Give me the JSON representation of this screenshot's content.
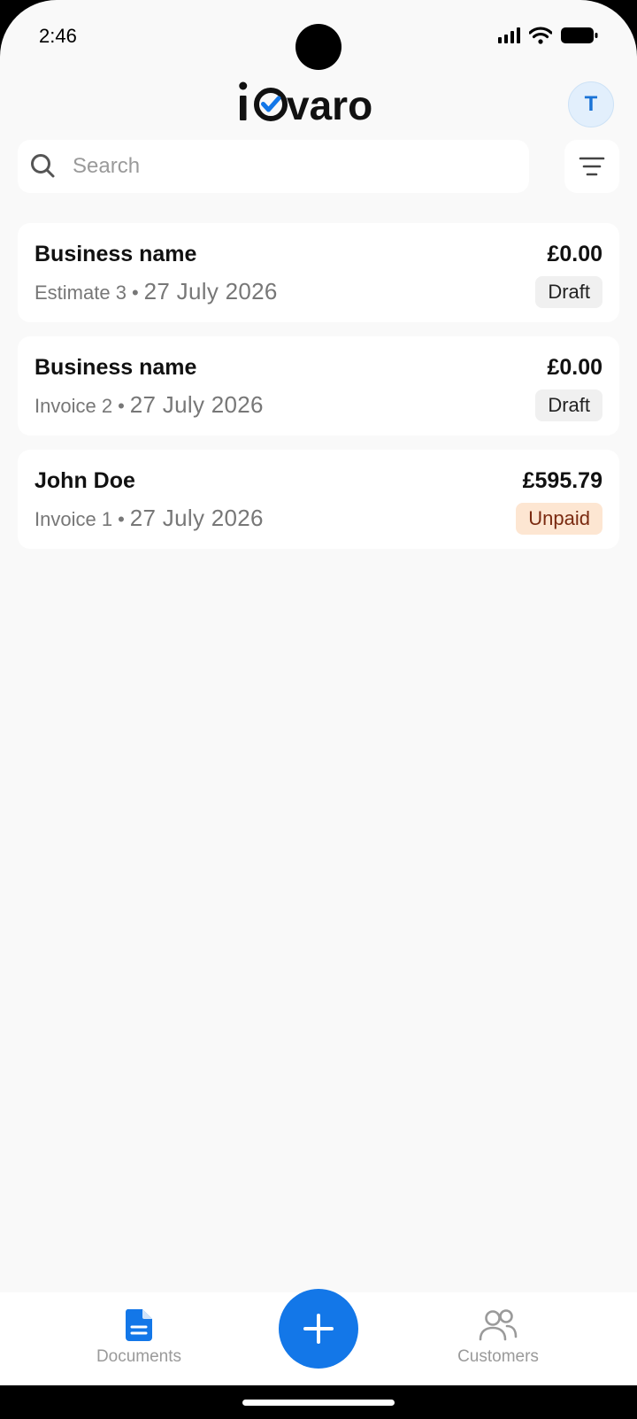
{
  "status_bar": {
    "time": "2:46"
  },
  "header": {
    "logo_text": "iOvaro",
    "avatar_initial": "T"
  },
  "search": {
    "placeholder": "Search",
    "value": ""
  },
  "documents": [
    {
      "name": "Business name",
      "amount": "£0.00",
      "type": "Estimate 3",
      "date": "27 July 2026",
      "status": "Draft"
    },
    {
      "name": "Business name",
      "amount": "£0.00",
      "type": "Invoice 2",
      "date": "27 July 2026",
      "status": "Draft"
    },
    {
      "name": "John Doe",
      "amount": "£595.79",
      "type": "Invoice 1",
      "date": "27 July 2026",
      "status": "Unpaid"
    }
  ],
  "tabs": {
    "documents": {
      "label": "Documents",
      "icon": "document-icon",
      "active": true
    },
    "add": {
      "icon": "plus-icon"
    },
    "customers": {
      "label": "Customers",
      "icon": "people-icon"
    }
  },
  "colors": {
    "accent": "#1377e8",
    "draft_badge_bg": "#f0f0f0",
    "unpaid_badge_bg": "#fde6d2",
    "unpaid_badge_text": "#7a2a10"
  }
}
